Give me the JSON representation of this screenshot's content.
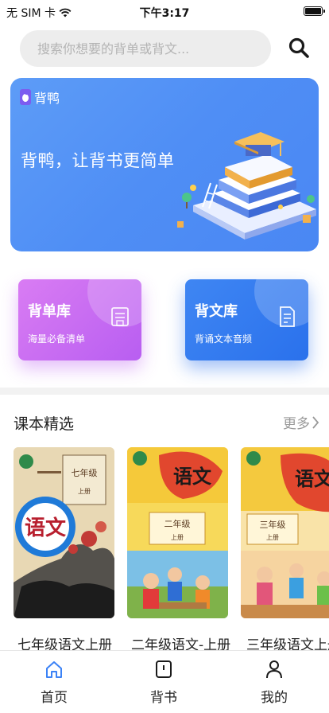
{
  "status_bar": {
    "carrier": "无 SIM 卡",
    "time": "下午3:17"
  },
  "search": {
    "placeholder": "搜索你想要的背单或背文..."
  },
  "banner": {
    "logo_text": "背鸭",
    "headline": "背鸭，让背书更简单"
  },
  "features": [
    {
      "title": "背单库",
      "subtitle": "海量必备清单",
      "icon": "notebook-icon",
      "color": "#c46ef2"
    },
    {
      "title": "背文库",
      "subtitle": "背诵文本音频",
      "icon": "document-icon",
      "color": "#3276ee"
    }
  ],
  "section": {
    "title": "课本精选",
    "more_label": "更多"
  },
  "books": [
    {
      "title": "七年级语文上册",
      "cover_title": "语文",
      "grade": "七年级",
      "volume": "上册"
    },
    {
      "title": "二年级语文-上册",
      "cover_title": "语文",
      "grade": "二年级",
      "volume": "上册"
    },
    {
      "title": "三年级语文上册",
      "cover_title": "语文",
      "grade": "三年级",
      "volume": "上册"
    }
  ],
  "tabbar": {
    "items": [
      {
        "label": "首页",
        "icon": "home-icon",
        "active": true
      },
      {
        "label": "背书",
        "icon": "book-icon",
        "active": false
      },
      {
        "label": "我的",
        "icon": "person-icon",
        "active": false
      }
    ]
  },
  "colors": {
    "accent": "#4a8cf5",
    "banner": "#4f8ef5",
    "vocab_card": "#c46ef2",
    "text_card": "#3276ee",
    "active_tab": "#3b82f6"
  }
}
